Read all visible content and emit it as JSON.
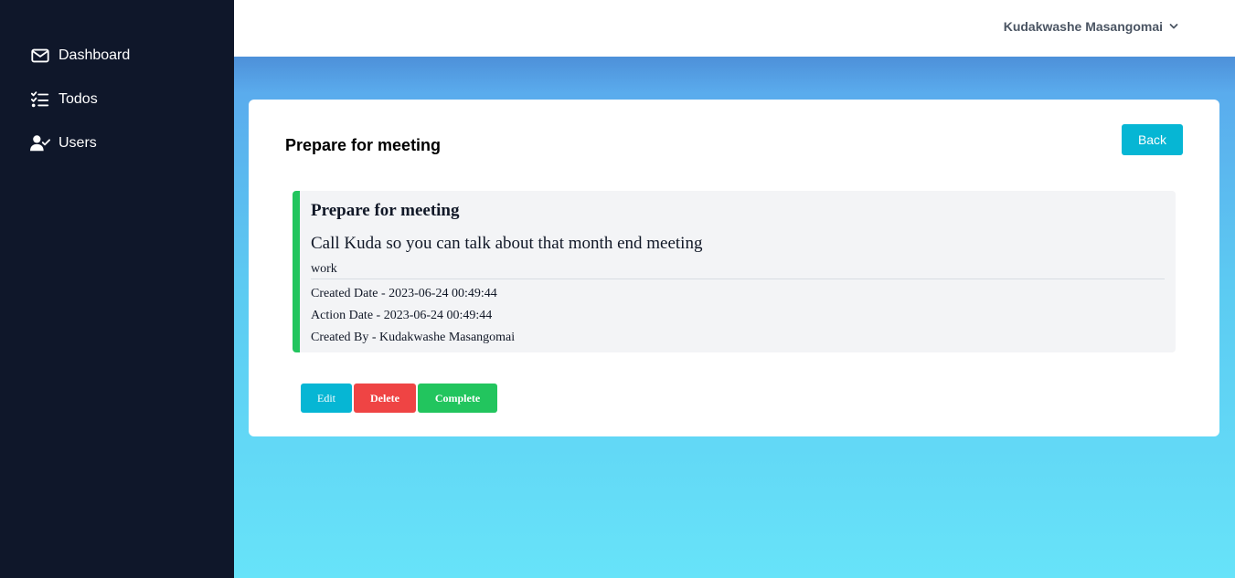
{
  "sidebar": {
    "items": [
      {
        "label": "Dashboard",
        "icon": "envelope-icon"
      },
      {
        "label": "Todos",
        "icon": "checklist-icon"
      },
      {
        "label": "Users",
        "icon": "user-check-icon"
      }
    ]
  },
  "header": {
    "user_name": "Kudakwashe Masangomai",
    "dropdown_icon": "chevron-down-icon"
  },
  "page": {
    "title": "Prepare for meeting",
    "back_label": "Back"
  },
  "todo": {
    "title": "Prepare for meeting",
    "description": "Call Kuda so you can talk about that month end meeting",
    "category": "work",
    "created_date": "Created Date - 2023-06-24 00:49:44",
    "action_date": "Action Date - 2023-06-24 00:49:44",
    "created_by": "Created By - Kudakwashe Masangomai"
  },
  "actions": {
    "edit_label": "Edit",
    "delete_label": "Delete",
    "complete_label": "Complete"
  },
  "colors": {
    "sidebar_bg": "#0f172a",
    "accent": "#06b6d4",
    "success": "#22c55e",
    "danger": "#ef4444"
  }
}
